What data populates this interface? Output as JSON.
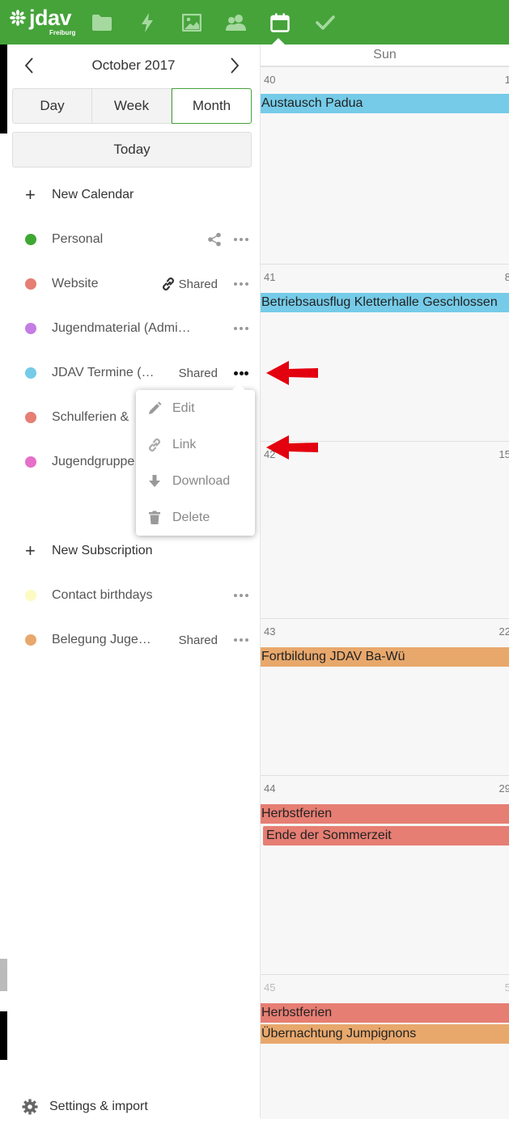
{
  "app": {
    "logo_text": "jdav",
    "logo_sub": "Freiburg",
    "apps": [
      "folder-icon",
      "activity-icon",
      "gallery-icon",
      "contacts-icon",
      "calendar-icon",
      "tasks-icon"
    ]
  },
  "nav": {
    "month": "October 2017",
    "views": [
      "Day",
      "Week",
      "Month"
    ],
    "active_view": "Month",
    "today": "Today"
  },
  "calendars": {
    "new_calendar": "New Calendar",
    "items": [
      {
        "name": "Personal",
        "color": "#3ea832",
        "action": "share"
      },
      {
        "name": "Website",
        "color": "#e67e73",
        "shared": "Shared"
      },
      {
        "name": "Jugendmaterial (Admi…",
        "color": "#c57de4"
      },
      {
        "name": "JDAV Termine (…",
        "color": "#75cbe8",
        "shared": "Shared"
      },
      {
        "name": "Schulferien &",
        "color": "#e67e73"
      },
      {
        "name": "Jugendgruppe",
        "color": "#e670c8"
      }
    ],
    "new_subscription": "New Subscription",
    "subscriptions": [
      {
        "name": "Contact birthdays",
        "color": "#fbfbc2"
      },
      {
        "name": "Belegung Juge…",
        "color": "#e8a86c",
        "shared": "Shared"
      }
    ],
    "settings": "Settings & import"
  },
  "menu": {
    "items": [
      "Edit",
      "Link",
      "Download",
      "Delete"
    ]
  },
  "calendar": {
    "day_header": "Sun",
    "weeks": [
      {
        "week": "40",
        "day": "1",
        "events": [
          {
            "title": "Austausch Padua",
            "color": "#75cbe8"
          }
        ]
      },
      {
        "week": "41",
        "day": "8",
        "events": [
          {
            "title": "Betriebsausflug Kletterhalle Geschlossen",
            "color": "#75cbe8"
          }
        ]
      },
      {
        "week": "42",
        "day": "15",
        "events": []
      },
      {
        "week": "43",
        "day": "22",
        "events": [
          {
            "title": "Fortbildung JDAV Ba-Wü",
            "color": "#e8a86c"
          }
        ]
      },
      {
        "week": "44",
        "day": "29",
        "events": [
          {
            "title": "Herbstferien",
            "color": "#e67e73"
          },
          {
            "title": "Ende der Sommerzeit",
            "color": "#e67e73"
          }
        ]
      },
      {
        "week": "45",
        "day": "5",
        "events": [
          {
            "title": "Herbstferien",
            "color": "#e67e73"
          },
          {
            "title": "Übernachtung Jumpignons",
            "color": "#e8a86c"
          }
        ]
      }
    ]
  }
}
